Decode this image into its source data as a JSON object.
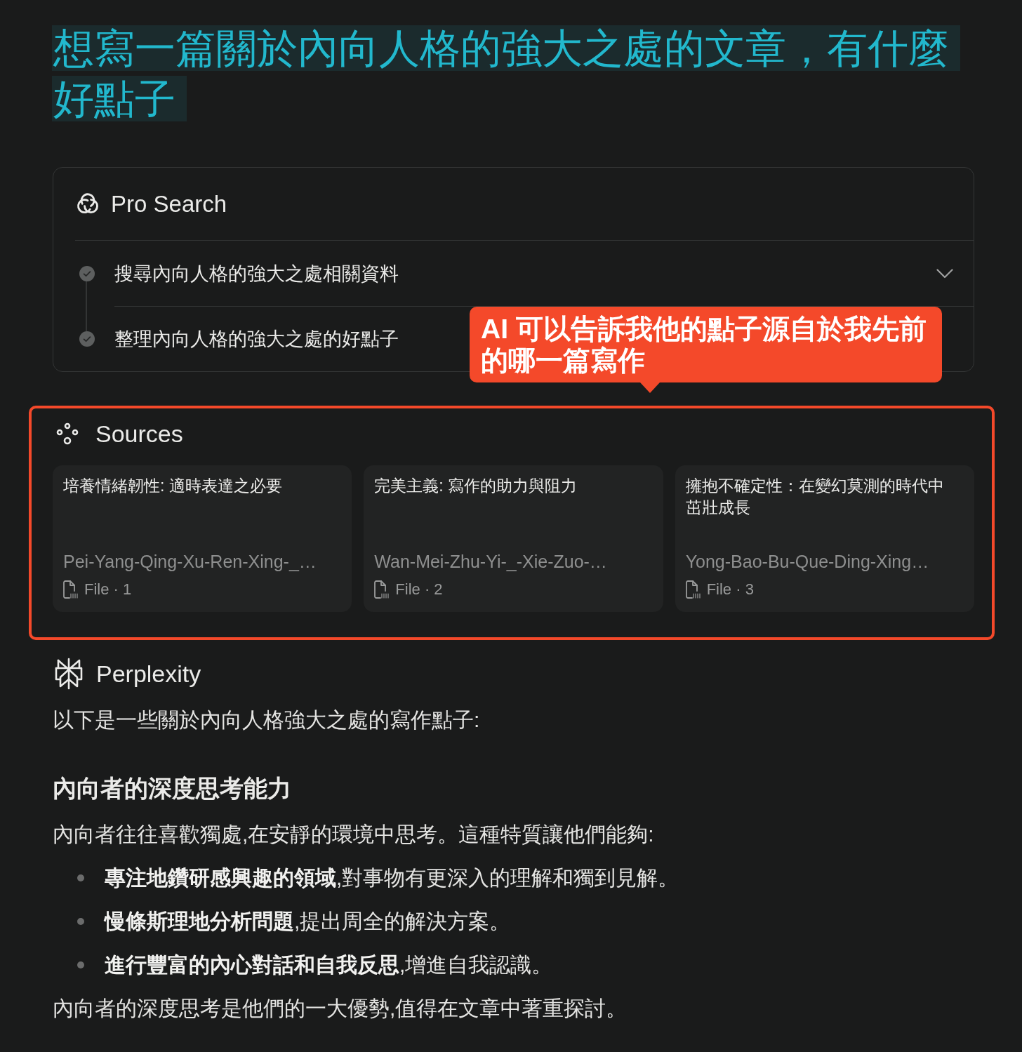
{
  "query": {
    "text": "想寫一篇關於內向人格的強大之處的文章，有什麼好點子"
  },
  "pro_search": {
    "title": "Pro Search",
    "expanded": false,
    "steps": [
      {
        "label": "搜尋內向人格的強大之處相關資料",
        "done": true
      },
      {
        "label": "整理內向人格的強大之處的好點子",
        "done": true
      }
    ]
  },
  "callout": {
    "text": "AI 可以告訴我他的點子源自於我先前的哪一篇寫作"
  },
  "sources": {
    "title": "Sources",
    "highlighted": true,
    "items": [
      {
        "title": "培養情緒韌性: 適時表達之必要",
        "filename": "Pei-Yang-Qing-Xu-Ren-Xing-_…",
        "meta": "File · 1"
      },
      {
        "title": "完美主義: 寫作的助力與阻力",
        "filename": "Wan-Mei-Zhu-Yi-_-Xie-Zuo-…",
        "meta": "File · 2"
      },
      {
        "title": "擁抱不確定性：在變幻莫測的時代中茁壯成長",
        "filename": "Yong-Bao-Bu-Que-Ding-Xing…",
        "meta": "File · 3"
      }
    ]
  },
  "answer": {
    "author": "Perplexity",
    "intro": "以下是一些關於內向人格強大之處的寫作點子:",
    "sections": [
      {
        "heading": "內向者的深度思考能力",
        "lead": "內向者往往喜歡獨處,在安靜的環境中思考。這種特質讓他們能夠:",
        "bullets": [
          "**專注地鑽研感興趣的領域**,對事物有更深入的理解和獨到見解。",
          "**慢條斯理地分析問題**,提出周全的解決方案。",
          "**進行豐富的內心對話和自我反思**,增進自我認識。"
        ],
        "conclusion": "內向者的深度思考是他們的一大優勢,值得在文章中著重探討。"
      }
    ]
  }
}
